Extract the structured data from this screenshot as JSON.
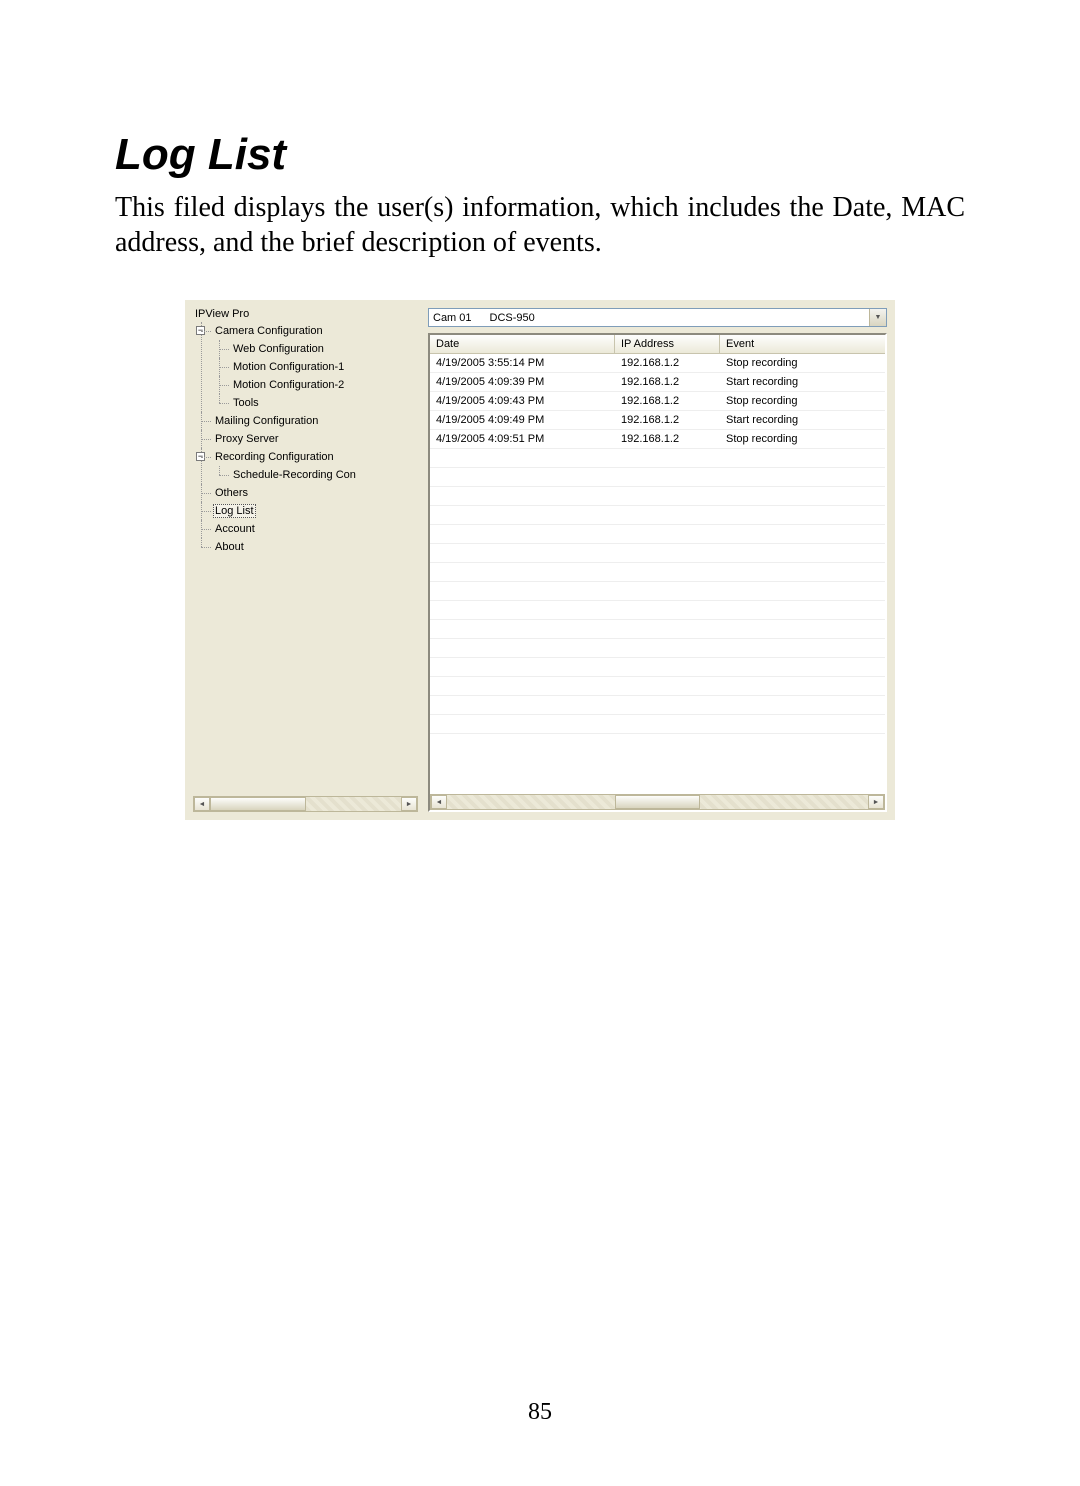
{
  "doc": {
    "heading": "Log List",
    "paragraph": "This filed displays the user(s) information, which includes the Date, MAC address, and the brief description of events.",
    "page_number": "85"
  },
  "app": {
    "title": "IPView Pro",
    "tree": {
      "root": [
        {
          "label": "Camera Configuration",
          "expander": "−",
          "children": [
            {
              "label": "Web Configuration"
            },
            {
              "label": "Motion Configuration-1"
            },
            {
              "label": "Motion Configuration-2"
            },
            {
              "label": "Tools"
            }
          ]
        },
        {
          "label": "Mailing Configuration"
        },
        {
          "label": "Proxy Server"
        },
        {
          "label": "Recording Configuration",
          "expander": "−",
          "children": [
            {
              "label": "Schedule-Recording Con"
            }
          ]
        },
        {
          "label": "Others"
        },
        {
          "label": "Log List",
          "selected": true
        },
        {
          "label": "Account"
        },
        {
          "label": "About"
        }
      ]
    },
    "combo": {
      "cam": "Cam 01",
      "model": "DCS-950"
    },
    "table": {
      "headers": {
        "date": "Date",
        "ip": "IP Address",
        "event": "Event"
      },
      "rows": [
        {
          "date": "4/19/2005 3:55:14 PM",
          "ip": "192.168.1.2",
          "event": "Stop recording"
        },
        {
          "date": "4/19/2005 4:09:39 PM",
          "ip": "192.168.1.2",
          "event": "Start recording"
        },
        {
          "date": "4/19/2005 4:09:43 PM",
          "ip": "192.168.1.2",
          "event": "Stop recording"
        },
        {
          "date": "4/19/2005 4:09:49 PM",
          "ip": "192.168.1.2",
          "event": "Start recording"
        },
        {
          "date": "4/19/2005 4:09:51 PM",
          "ip": "192.168.1.2",
          "event": "Stop recording"
        }
      ]
    }
  }
}
